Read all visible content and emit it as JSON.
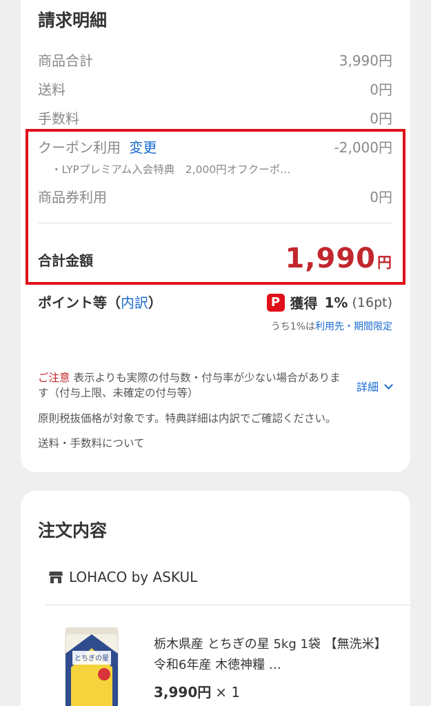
{
  "billing": {
    "title": "請求明細",
    "rows": [
      {
        "label": "商品合計",
        "value": "3,990円"
      },
      {
        "label": "送料",
        "value": "0円"
      },
      {
        "label": "手数料",
        "value": "0円"
      }
    ],
    "coupon": {
      "label": "クーポン利用",
      "change_link": "変更",
      "value": "-2,000円",
      "detail": "・LYPプレミアム入会特典　2,000円オフクーポ…"
    },
    "gift": {
      "label": "商品券利用",
      "value": "0円"
    },
    "total": {
      "label": "合計金額",
      "value": "1,990",
      "unit": "円"
    },
    "points": {
      "label": "ポイント等（",
      "link": "内訳",
      "label_close": "）",
      "icon": "P",
      "earn": "獲得",
      "pct": "1%",
      "amount": "(16pt)",
      "sub_prefix": "うち1%は",
      "sub_link": "利用先・期間限定"
    },
    "notice": {
      "warn": "ご注意",
      "text": " 表示よりも実際の付与数・付与率が少ない場合があります（付与上限、未確定の付与等）",
      "detail_link": "詳細"
    },
    "note_tax": "原則税抜価格が対象です。特典詳細は内訳でご確認ください。",
    "note_shipping": "送料・手数料について"
  },
  "order": {
    "title": "注文内容",
    "store": "LOHACO by ASKUL",
    "product": {
      "name": "栃木県産 とちぎの星 5kg 1袋 【無洗米】 令和6年産 木徳神糧 …",
      "price": "3,990円",
      "qty": "× 1",
      "image_text": "とちぎの星"
    }
  },
  "colors": {
    "accent": "#c1272d",
    "link": "#1a6bcf",
    "highlight": "#e0101a"
  }
}
